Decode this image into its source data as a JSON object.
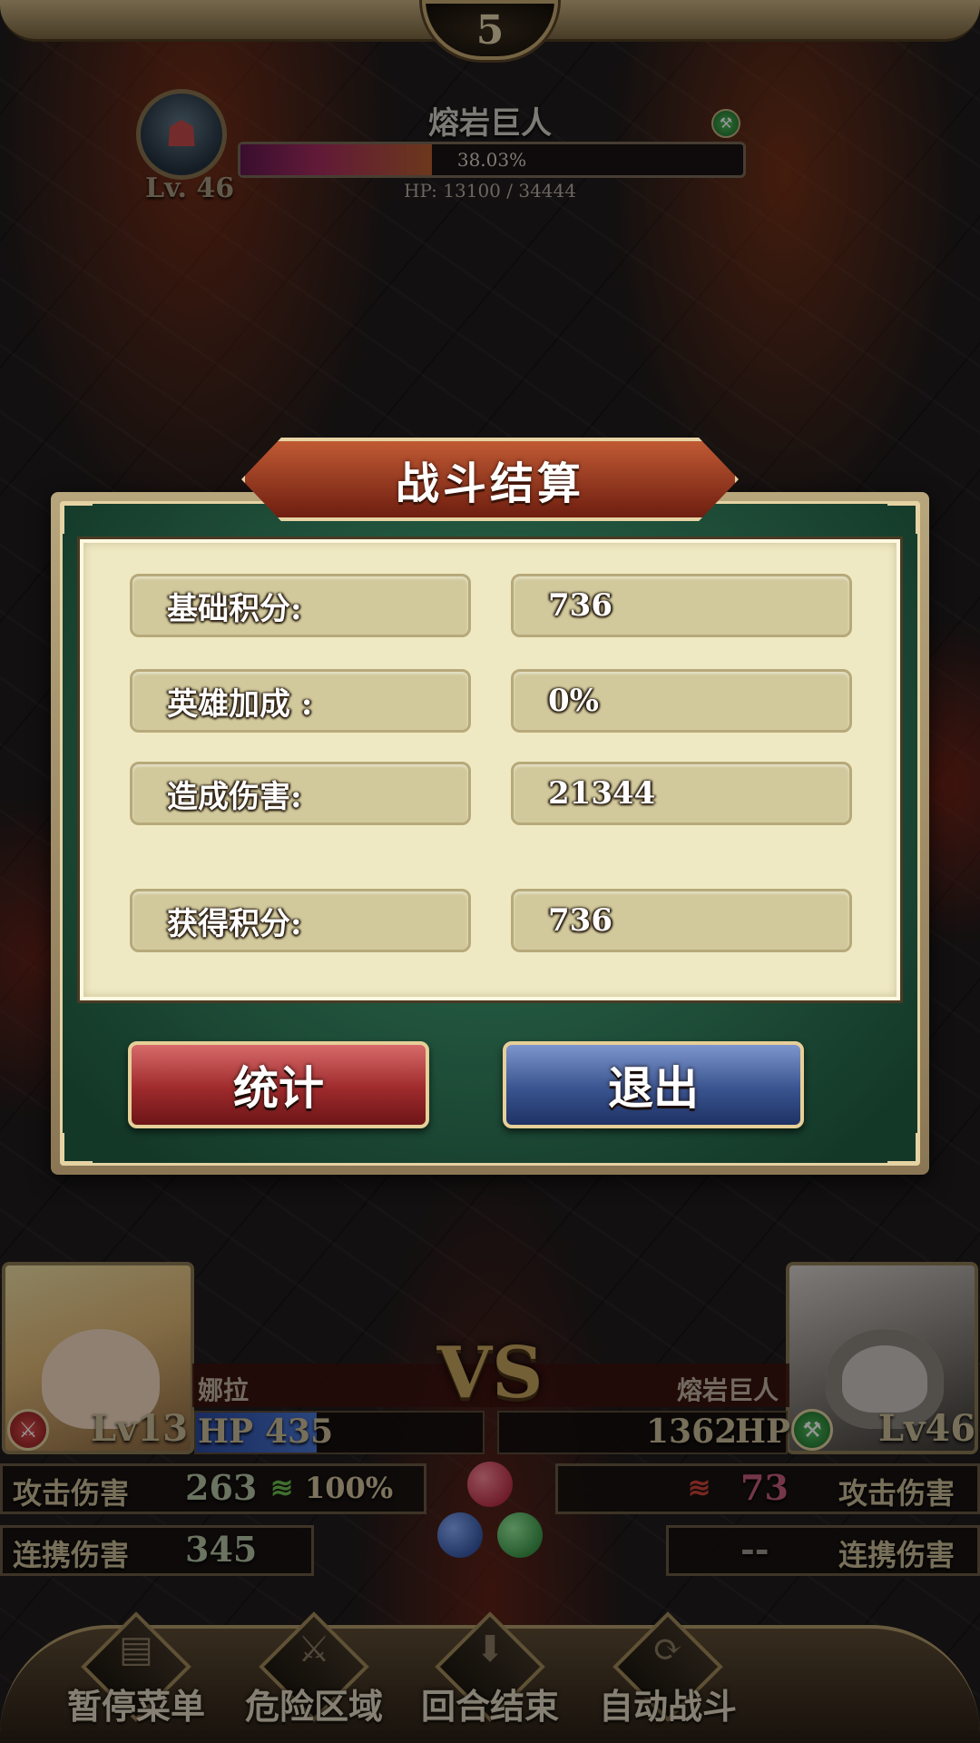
{
  "top": {
    "round_number": "5",
    "boss": {
      "name": "熔岩巨人",
      "level": "Lv. 46",
      "hp_percent_text": "38.03%",
      "hp_fraction": 0.3803,
      "hp_text": "HP: 13100 / 34444"
    }
  },
  "dialog": {
    "title": "战斗结算",
    "rows": [
      {
        "label": "基础积分:",
        "value": "736"
      },
      {
        "label": "英雄加成 :",
        "value": "0%"
      },
      {
        "label": "造成伤害:",
        "value": "21344"
      },
      {
        "label": "获得积分:",
        "value": "736"
      }
    ],
    "buttons": {
      "stats": "统计",
      "exit": "退出"
    }
  },
  "battle": {
    "player": {
      "name": "娜拉",
      "level": "Lv13",
      "hp_label": "HP",
      "hp": "435",
      "hp_fraction": 0.42,
      "attack_damage": "263",
      "attack_bonus": "100%",
      "combo_damage": "345"
    },
    "enemy": {
      "name": "熔岩巨人",
      "level": "Lv46",
      "hp": "1362",
      "hp_label": "HP",
      "attack_damage": "73",
      "combo_damage": "--"
    },
    "vs": "VS",
    "attack_label": "攻击伤害",
    "combo_label": "连携伤害"
  },
  "bottom_nav": {
    "items": [
      {
        "label": "暂停菜单",
        "icon": "book-icon"
      },
      {
        "label": "危险区域",
        "icon": "crossed-swords-icon"
      },
      {
        "label": "回合结束",
        "icon": "download-arrow-icon"
      },
      {
        "label": "自动战斗",
        "icon": "refresh-icon"
      }
    ]
  },
  "colors": {
    "accent_gold": "#c9b383",
    "panel_green": "#1f5a40",
    "button_red": "#9e2a2c",
    "button_blue": "#39548f"
  }
}
